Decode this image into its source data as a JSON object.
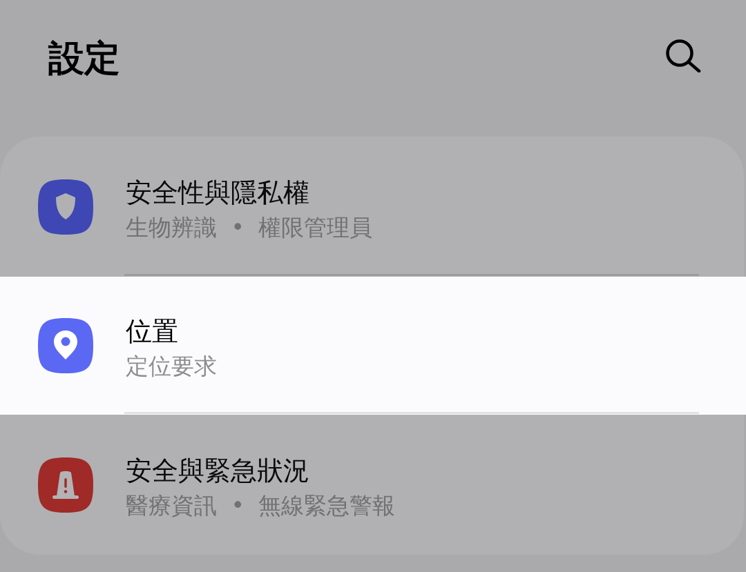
{
  "header": {
    "title": "設定"
  },
  "items": [
    {
      "title": "安全性與隱私權",
      "subtitle": "生物辨識 • 權限管理員",
      "color": "#3e47b3",
      "selected": false
    },
    {
      "title": "位置",
      "subtitle": "定位要求",
      "color": "#5a68f4",
      "selected": true
    },
    {
      "title": "安全與緊急狀況",
      "subtitle": "醫療資訊 • 無線緊急警報",
      "color": "#a02a27",
      "selected": false
    }
  ]
}
